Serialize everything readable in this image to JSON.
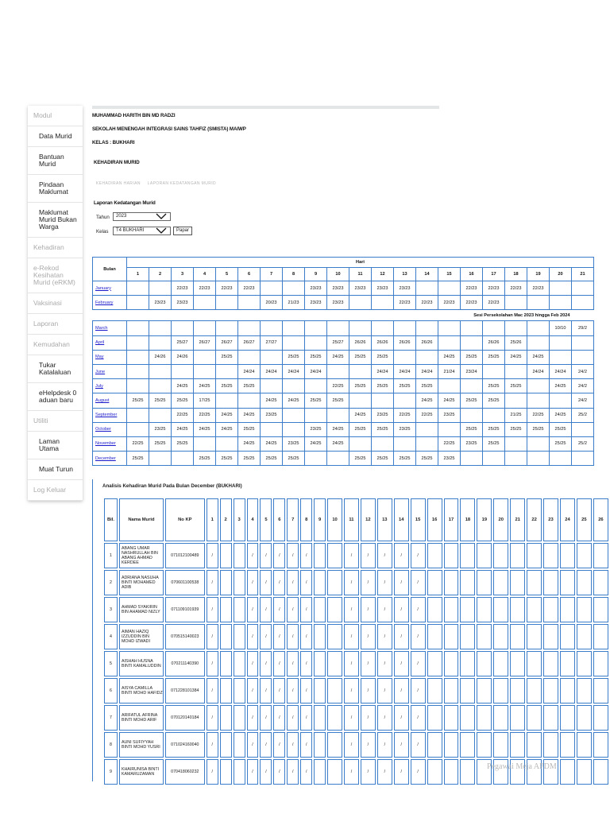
{
  "sidebar": {
    "items": [
      {
        "label": "Modul",
        "header": true
      },
      {
        "label": "Data Murid"
      },
      {
        "label": "Bantuan Murid"
      },
      {
        "label": "Pindaan Maklumat"
      },
      {
        "label": "Maklumat Murid Bukan Warga"
      },
      {
        "label": "Kehadiran",
        "header": true
      },
      {
        "label": "e-Rekod Kesihatan Murid (eRKM)",
        "header": true
      },
      {
        "label": "Vaksinasi",
        "header": true
      },
      {
        "label": "Laporan",
        "header": true
      },
      {
        "label": "Kemudahan",
        "header": true
      },
      {
        "label": "Tukar Katalaluan"
      },
      {
        "label": "eHelpdesk 0 aduan baru"
      },
      {
        "label": "Utiliti",
        "header": true
      },
      {
        "label": "Laman Utama"
      },
      {
        "label": "Muat Turun"
      },
      {
        "label": "Log Keluar",
        "header": true
      }
    ]
  },
  "header": {
    "student_name": "MUHAMMAD HARITH BIN MD RADZI",
    "school": "SEKOLAH MENENGAH INTEGRASI SAINS TAHFIZ (SMISTA) MAIWP",
    "kelas": "KELAS : BUKHARI",
    "section": "KEHADIRAN MURID"
  },
  "tabs": [
    "KEHADIRAN HARIAN",
    "LAPORAN KEDATANGAN MURID"
  ],
  "form": {
    "title": "Laporan Kedatangan Murid",
    "tahun_label": "Tahun",
    "tahun_value": "2023",
    "kelas_label": "Kelas",
    "kelas_value": "T4 BUKHARI",
    "papar_label": "Papar",
    "chevron": "chevron-down-icon"
  },
  "attendance": {
    "bulan_label": "Bulan",
    "hari_label": "Hari",
    "days": [
      "1",
      "2",
      "3",
      "4",
      "5",
      "6",
      "7",
      "8",
      "9",
      "10",
      "11",
      "12",
      "13",
      "14",
      "15",
      "16",
      "17",
      "18",
      "19",
      "20",
      "21"
    ],
    "sesi_note": "Sesi Persekolahan Mac 2023 hingga Feb 2024",
    "months_before": [
      {
        "name": "January",
        "cells": [
          "",
          "",
          "22/23",
          "22/23",
          "22/23",
          "22/23",
          "",
          "",
          "23/23",
          "23/23",
          "23/23",
          "23/23",
          "23/23",
          "",
          "",
          "22/23",
          "22/23",
          "22/23",
          "22/23",
          "",
          ""
        ]
      },
      {
        "name": "February",
        "cells": [
          "",
          "23/23",
          "23/23",
          "",
          "",
          "",
          "20/23",
          "21/23",
          "23/23",
          "23/23",
          "",
          "",
          "22/23",
          "22/23",
          "22/23",
          "22/23",
          "22/23",
          "",
          "",
          "",
          ""
        ]
      }
    ],
    "months_after": [
      {
        "name": "March",
        "cells": [
          "",
          "",
          "",
          "",
          "",
          "",
          "",
          "",
          "",
          "",
          "",
          "",
          "",
          "",
          "",
          "",
          "",
          "",
          "",
          "10/10",
          "29/2"
        ]
      },
      {
        "name": "April",
        "cells": [
          "",
          "",
          "25/27",
          "26/27",
          "26/27",
          "26/27",
          "27/27",
          "",
          "",
          "25/27",
          "26/26",
          "26/26",
          "26/26",
          "26/26",
          "",
          "",
          "26/26",
          "25/26",
          "",
          "",
          ""
        ]
      },
      {
        "name": "May",
        "cells": [
          "",
          "24/26",
          "24/26",
          "",
          "25/25",
          "",
          "",
          "25/25",
          "25/25",
          "24/25",
          "25/25",
          "25/25",
          "",
          "",
          "24/25",
          "25/25",
          "25/25",
          "24/25",
          "24/25",
          "",
          ""
        ]
      },
      {
        "name": "June",
        "cells": [
          "",
          "",
          "",
          "",
          "",
          "24/24",
          "24/24",
          "24/24",
          "24/24",
          "",
          "",
          "24/24",
          "24/24",
          "24/24",
          "21/24",
          "23/24",
          "",
          "",
          "24/24",
          "24/24",
          "24/2"
        ]
      },
      {
        "name": "July",
        "cells": [
          "",
          "",
          "24/25",
          "24/25",
          "25/25",
          "25/25",
          "",
          "",
          "",
          "22/25",
          "25/25",
          "25/25",
          "25/25",
          "25/25",
          "",
          "",
          "25/25",
          "25/25",
          "",
          "24/25",
          "24/2"
        ]
      },
      {
        "name": "August",
        "cells": [
          "25/25",
          "25/25",
          "25/25",
          "17/25",
          "",
          "",
          "24/25",
          "24/25",
          "25/25",
          "25/25",
          "",
          "",
          "",
          "24/25",
          "24/25",
          "25/25",
          "25/25",
          "",
          "",
          "",
          "24/2"
        ]
      },
      {
        "name": "September",
        "cells": [
          "",
          "",
          "22/25",
          "22/25",
          "24/25",
          "24/25",
          "23/25",
          "",
          "",
          "",
          "24/25",
          "23/25",
          "22/25",
          "22/25",
          "23/25",
          "",
          "",
          "21/25",
          "22/25",
          "24/25",
          "25/2"
        ]
      },
      {
        "name": "October",
        "cells": [
          "",
          "23/25",
          "24/25",
          "24/25",
          "24/25",
          "25/25",
          "",
          "",
          "23/25",
          "24/25",
          "25/25",
          "25/25",
          "23/25",
          "",
          "",
          "25/25",
          "25/25",
          "25/25",
          "25/25",
          "25/25",
          ""
        ]
      },
      {
        "name": "November",
        "cells": [
          "22/25",
          "25/25",
          "25/25",
          "",
          "",
          "24/25",
          "24/25",
          "23/25",
          "24/25",
          "24/25",
          "",
          "",
          "",
          "",
          "22/25",
          "23/25",
          "25/25",
          "",
          "",
          "25/25",
          "25/2"
        ]
      },
      {
        "name": "December",
        "cells": [
          "25/25",
          "",
          "",
          "25/25",
          "25/25",
          "25/25",
          "25/25",
          "25/25",
          "",
          "",
          "25/25",
          "25/25",
          "25/25",
          "25/25",
          "23/25",
          "",
          "",
          "",
          "",
          "",
          ""
        ]
      }
    ]
  },
  "analysis": {
    "title": "Analisis Kehadiran Murid Pada Bulan December (BUKHARI)",
    "col_bil": "Bil.",
    "col_nama": "Nama Murid",
    "col_nokp": "No KP",
    "days": [
      "1",
      "2",
      "3",
      "4",
      "5",
      "6",
      "7",
      "8",
      "9",
      "10",
      "11",
      "12",
      "13",
      "14",
      "15",
      "16",
      "17",
      "18",
      "19",
      "20",
      "21",
      "22",
      "23",
      "24",
      "25",
      "26"
    ],
    "marks": [
      "/",
      "",
      "",
      "/",
      "/",
      "/",
      "/",
      "/",
      "",
      "",
      "/",
      "/",
      "/",
      "/",
      "/",
      "",
      "",
      "",
      "",
      "",
      "",
      "",
      "",
      "",
      "",
      ""
    ],
    "students": [
      {
        "bil": "1",
        "nama": "ABANG UMAR NASHRULLAH BIN ABANG AHMAD KERDEE",
        "nokp": "071012100489"
      },
      {
        "bil": "2",
        "nama": "ADRIANA NASUHA BINTI MOHAMED ADIB",
        "nokp": "070601100538"
      },
      {
        "bil": "3",
        "nama": "AHMAD SYAKIRIN BIN AHAMAD NIZLY",
        "nokp": "071109101939"
      },
      {
        "bil": "4",
        "nama": "AIMAN HAZIQ IZZUDDIN BIN MOHD IZWADI",
        "nokp": "070515140023"
      },
      {
        "bil": "5",
        "nama": "AISHAH HUSNA BINTI KAMALUDDIN",
        "nokp": "070211140390"
      },
      {
        "bil": "6",
        "nama": "AISYA CAMILLA BINTI MOHD HAFIDZ",
        "nokp": "071228101384"
      },
      {
        "bil": "7",
        "nama": "ARIFATUL AFRINA BINTI MOHD ARIF",
        "nokp": "070120140184"
      },
      {
        "bil": "8",
        "nama": "AUNI SUFIYYAH BINTI MOHD YUSRI",
        "nokp": "071024160040"
      },
      {
        "bil": "9",
        "nama": "KHAIRUNISA BINTI KAMARUZAMAN",
        "nokp": "070418060232"
      }
    ]
  },
  "watermark": "Pegawai Meja APDM"
}
